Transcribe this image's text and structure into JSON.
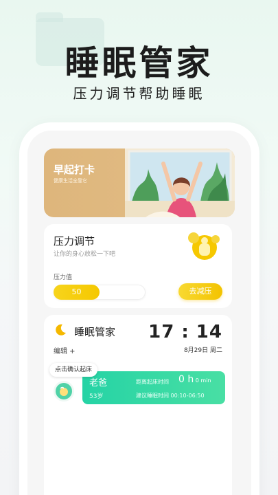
{
  "hero": {
    "title": "睡眠管家",
    "subtitle": "压力调节帮助睡眠"
  },
  "morning_card": {
    "title": "早起打卡",
    "subtitle": "健康生活全靠它"
  },
  "pressure_card": {
    "title": "压力调节",
    "subtitle": "让你的身心放松一下吧",
    "label": "压力值",
    "value": "50",
    "value_fraction": 0.5,
    "button": "去减压"
  },
  "sleep_card": {
    "title": "睡眠管家",
    "edit": "编辑 +",
    "time": "17 : 14",
    "date": "8月29日  周二",
    "confirm": "点击确认起床",
    "user_name": "老爸",
    "user_age": "53岁",
    "wake_label": "距离起床时间",
    "wake_value": "0 h",
    "wake_unit": " 0 min",
    "suggest": "建议睡眠时间 00:10-06:50"
  },
  "colors": {
    "accent_green": "#25d3a5",
    "accent_yellow": "#f5c800",
    "morning_bg": "#deb67c"
  }
}
